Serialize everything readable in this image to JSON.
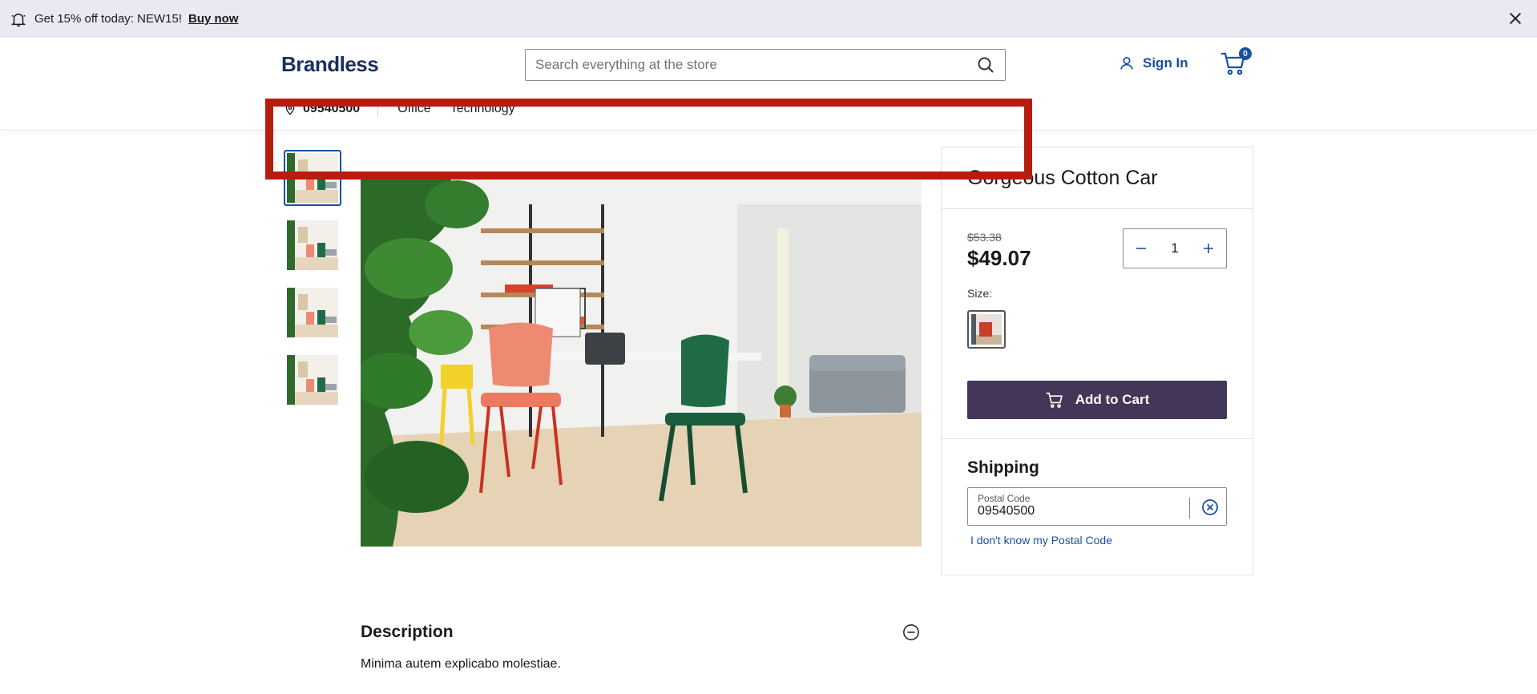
{
  "promo": {
    "text": "Get 15% off today: NEW15!",
    "link": "Buy now"
  },
  "header": {
    "logo": "Brandless",
    "search_placeholder": "Search everything at the store",
    "sign_in": "Sign In",
    "cart_count": "0"
  },
  "subnav": {
    "postal": "09540500",
    "links": [
      "Office",
      "Technology"
    ]
  },
  "product": {
    "title": "Gorgeous Cotton Car",
    "old_price": "$53.38",
    "price": "$49.07",
    "quantity": "1",
    "size_label": "Size:",
    "add_to_cart": "Add to Cart"
  },
  "shipping": {
    "title": "Shipping",
    "postal_label": "Postal Code",
    "postal_value": "09540500",
    "help_link": "I don't know my Postal Code"
  },
  "description": {
    "title": "Description",
    "text": "Minima autem explicabo molestiae."
  },
  "colors": {
    "accent": "#1a4fa3",
    "button": "#433658",
    "promo_bg": "#ece8f2",
    "highlight": "#b71c10"
  }
}
